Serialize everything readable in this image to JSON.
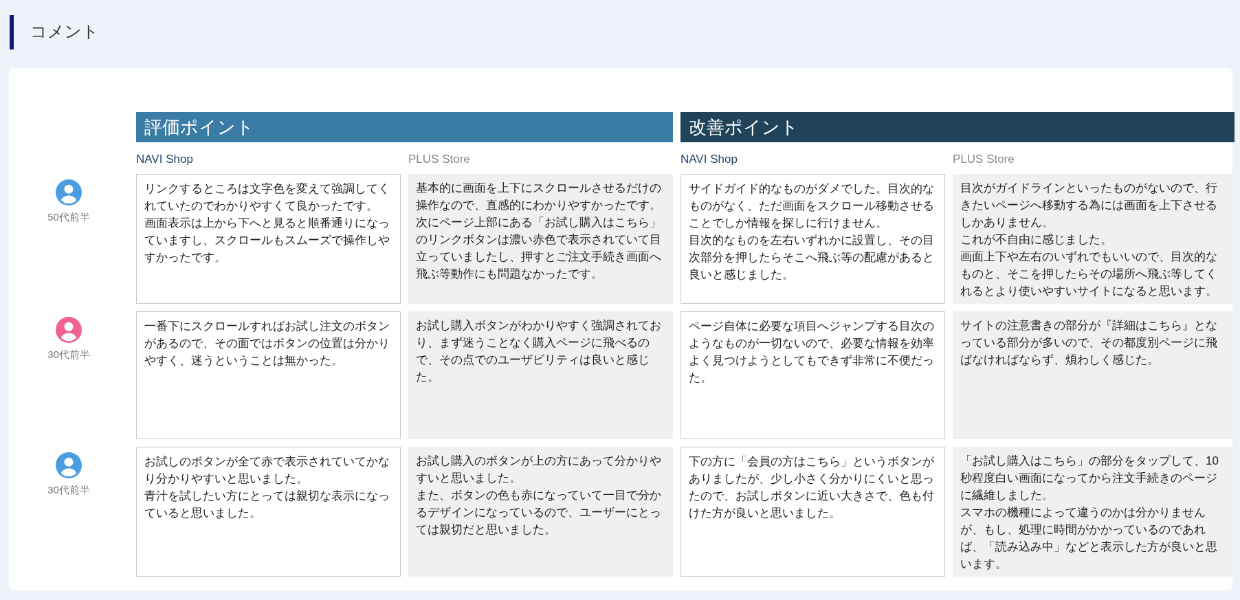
{
  "page_title": "コメント",
  "sections": [
    {
      "title": "評価ポイント",
      "kind": "positive",
      "stores": [
        "NAVI Shop",
        "PLUS Store"
      ]
    },
    {
      "title": "改善ポイント",
      "kind": "improvement",
      "stores": [
        "NAVI Shop",
        "PLUS Store"
      ]
    }
  ],
  "respondents": [
    {
      "age": "50代前半",
      "color": "#4a9de0",
      "comments": [
        [
          "リンクするところは文字色を変えて強調してくれていたのでわかりやすくて良かったです。",
          "画面表示は上から下へと見ると順番通りになっていますし、スクロールもスムーズで操作しやすかったです。"
        ],
        [
          "基本的に画面を上下にスクロールさせるだけの操作なので、直感的にわかりやすかったです。",
          "次にページ上部にある「お試し購入はこちら」のリンクボタンは濃い赤色で表示されていて目立っていましたし、押すとご注文手続き画面へ飛ぶ等動作にも問題なかったです。"
        ],
        [
          "サイドガイド的なものがダメでした。目次的なものがなく、ただ画面をスクロール移動させることでしか情報を探しに行けません。",
          "目次的なものを左右いずれかに設置し、その目次部分を押したらそこへ飛ぶ等の配慮があると良いと感じました。"
        ],
        [
          "目次がガイドラインといったものがないので、行きたいページへ移動する為には画面を上下させるしかありません。",
          "これが不自由に感じました。",
          "画面上下や左右のいずれでもいいので、目次的なものと、そこを押したらその場所へ飛ぶ等してくれるとより使いやすいサイトになると思います。"
        ]
      ]
    },
    {
      "age": "30代前半",
      "color": "#f06292",
      "comments": [
        [
          "一番下にスクロールすればお試し注文のボタンがあるので、その面ではボタンの位置は分かりやすく、迷うということは無かった。"
        ],
        [
          "お試し購入ボタンがわかりやすく強調されており、まず迷うことなく購入ページに飛べるので、その点でのユーザビリティは良いと感じた。"
        ],
        [
          "ページ自体に必要な項目へジャンプする目次のようなものが一切ないので、必要な情報を効率よく見つけようとしてもできず非常に不便だった。"
        ],
        [
          "サイトの注意書きの部分が『詳細はこちら』となっている部分が多いので、その都度別ページに飛ばなければならず、煩わしく感じた。"
        ]
      ]
    },
    {
      "age": "30代前半",
      "color": "#4a9de0",
      "comments": [
        [
          "お試しのボタンが全て赤で表示されていてかなり分かりやすいと思いました。",
          "青汁を試したい方にとっては親切な表示になっていると思いました。"
        ],
        [
          "お試し購入のボタンが上の方にあって分かりやすいと思いました。",
          "また、ボタンの色も赤になっていて一目で分かるデザインになっているので、ユーザーにとっては親切だと思いました。"
        ],
        [
          "下の方に「会員の方はこちら」というボタンがありましたが、少し小さく分かりにくいと思ったので、お試しボタンに近い大きさで、色も付けた方が良いと思いました。"
        ],
        [
          "「お試し購入はこちら」の部分をタップして、10秒程度白い画面になってから注文手続きのページに繊維しました。",
          "スマホの機種によって違うのかは分かりませんが、もし、処理に時間がかかっているのであれば、「読み込み中」などと表示した方が良いと思います。"
        ]
      ]
    }
  ]
}
